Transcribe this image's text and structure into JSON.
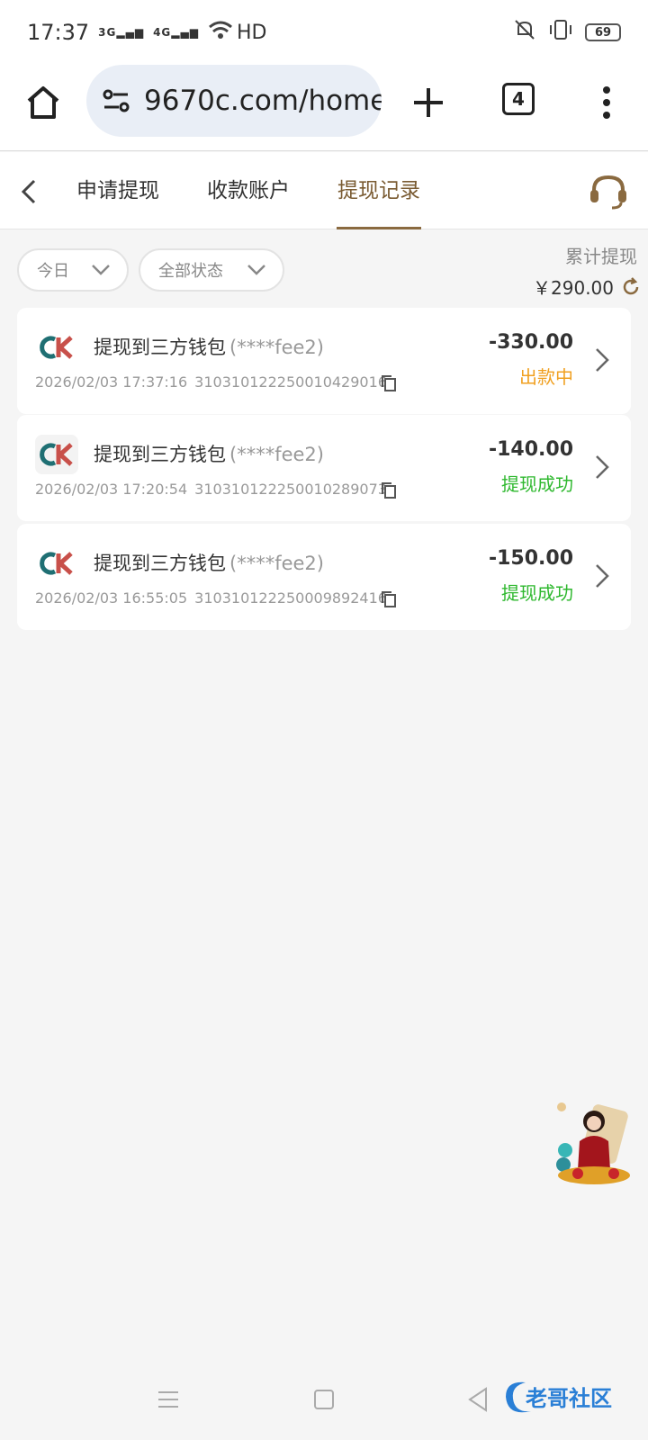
{
  "status_bar": {
    "time": "17:37",
    "net1": "3G",
    "net2": "4G",
    "hd": "HD",
    "battery": "69"
  },
  "browser": {
    "url": "9670c.com/home",
    "tab_count": "4"
  },
  "tabs": [
    {
      "label": "申请提现"
    },
    {
      "label": "收款账户"
    },
    {
      "label": "提现记录"
    }
  ],
  "filters": {
    "date": "今日",
    "status": "全部状态"
  },
  "summary": {
    "label": "累计提现",
    "value": "￥290.00"
  },
  "records": [
    {
      "title": "提现到三方钱包",
      "account": "(****fee2)",
      "datetime": "2026/02/03 17:37:16",
      "order_id": "310310122250010429016",
      "amount": "-330.00",
      "status": "出款中",
      "status_color": "#f0a020"
    },
    {
      "title": "提现到三方钱包",
      "account": "(****fee2)",
      "datetime": "2026/02/03 17:20:54",
      "order_id": "310310122250010289073",
      "amount": "-140.00",
      "status": "提现成功",
      "status_color": "#2eb82e"
    },
    {
      "title": "提现到三方钱包",
      "account": "(****fee2)",
      "datetime": "2026/02/03 16:55:05",
      "order_id": "310310122250009892416",
      "amount": "-150.00",
      "status": "提现成功",
      "status_color": "#2eb82e"
    }
  ],
  "watermark": "老哥社区",
  "colors": {
    "accent": "#8a6a40",
    "pending": "#f0a020",
    "success": "#2eb82e"
  }
}
